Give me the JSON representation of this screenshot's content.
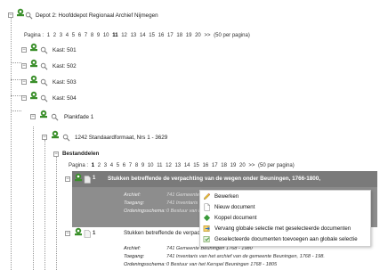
{
  "tree": {
    "depot_label": "Depot 2: Hoofddepot Regionaal Archief Nijmegen",
    "pagination_top": {
      "prefix": "Pagina :",
      "pages": [
        "1",
        "2",
        "3",
        "4",
        "5",
        "6",
        "7",
        "8",
        "9",
        "10",
        "11",
        "12",
        "13",
        "14",
        "15",
        "16",
        "17",
        "18",
        "19",
        "20"
      ],
      "current": "11",
      "next": ">>",
      "per_page": "(50 per pagina)"
    },
    "kast_501": "Kast: 501",
    "kast_502": "Kast: 502",
    "kast_503": "Kast: 503",
    "kast_504": "Kast: 504",
    "plank": "Plankfade 1",
    "standaard": "1242 Standaardformaat, Nrs 1 - 3629",
    "bestanddelen": "Bestanddelen",
    "pagination_inner": {
      "prefix": "Pagina :",
      "pages": [
        "1",
        "2",
        "3",
        "4",
        "5",
        "6",
        "7",
        "8",
        "9",
        "10",
        "11",
        "12",
        "13",
        "14",
        "15",
        "16",
        "17",
        "18",
        "19",
        "20"
      ],
      "current": "1",
      "next": ">>",
      "per_page": "(50 per pagina)"
    }
  },
  "record1": {
    "num": "1",
    "title": "Stukken betreffende de verpachting van de wegen onder Beuningen, 1766-1800,",
    "archief_key": "Archief:",
    "archief_val": "741 Gemeente Beuningen 1768 - 1980",
    "toegang_key": "Toegang:",
    "toegang_val": "741 Inventaris van het archief van de gemeente Beuningen",
    "ordening_key": "Ordeningsschema:",
    "ordening_val": "0 Bestuur van het Kerspel Beuningen 1768 - 1805"
  },
  "record2": {
    "num": "1",
    "title": "Stukken betreffende de verpac",
    "archief_key": "Archief:",
    "archief_val": "741 Gemeente Beuningen 1768 - 1980",
    "toegang_key": "Toegang:",
    "toegang_val": "741 Inventaris van het archief van de gemeente Beuningen, 1768 - 198.",
    "ordening_key": "Ordeningsschema:",
    "ordening_val": "0 Bestuur van het Kerspel Beuningen 1768 - 1805"
  },
  "context_menu": {
    "items": [
      {
        "label": "Bewerken",
        "icon": "pencil-icon"
      },
      {
        "label": "Nieuw document",
        "icon": "new-document-icon"
      },
      {
        "label": "Koppel document",
        "icon": "link-document-icon"
      },
      {
        "label": "Vervang globale selectie met geselecteerde documenten",
        "icon": "replace-selection-icon"
      },
      {
        "label": "Geselecteerde documenten toevoegen aan globale selectie",
        "icon": "add-selection-icon"
      }
    ]
  },
  "colors": {
    "selected_bar": "#7a7a7a",
    "selected_card": "#8d8d8d",
    "icon_green": "#3a8f2a"
  }
}
